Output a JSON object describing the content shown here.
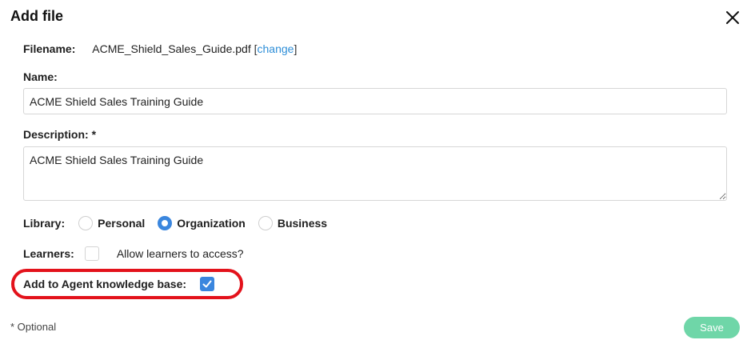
{
  "dialog": {
    "title": "Add file",
    "close_icon": "close-icon"
  },
  "filename": {
    "label": "Filename:",
    "value": "ACME_Shield_Sales_Guide.pdf",
    "bracket_open": "[",
    "change_link": "change",
    "bracket_close": "]"
  },
  "name": {
    "label": "Name:",
    "value": "ACME Shield Sales Training Guide"
  },
  "description": {
    "label": "Description: *",
    "value": "ACME Shield Sales Training Guide"
  },
  "library": {
    "label": "Library:",
    "options": [
      "Personal",
      "Organization",
      "Business"
    ],
    "selected": "Organization"
  },
  "learners": {
    "label": "Learners:",
    "checkbox_text": "Allow learners to access?",
    "checked": false
  },
  "agent": {
    "label": "Add to Agent knowledge base:",
    "checked": true
  },
  "footer": {
    "optional_note": "* Optional",
    "save_label": "Save"
  },
  "colors": {
    "accent": "#3a86de",
    "link": "#2f8fd8",
    "save_button": "#6fd6a8",
    "highlight": "#e3121b"
  }
}
